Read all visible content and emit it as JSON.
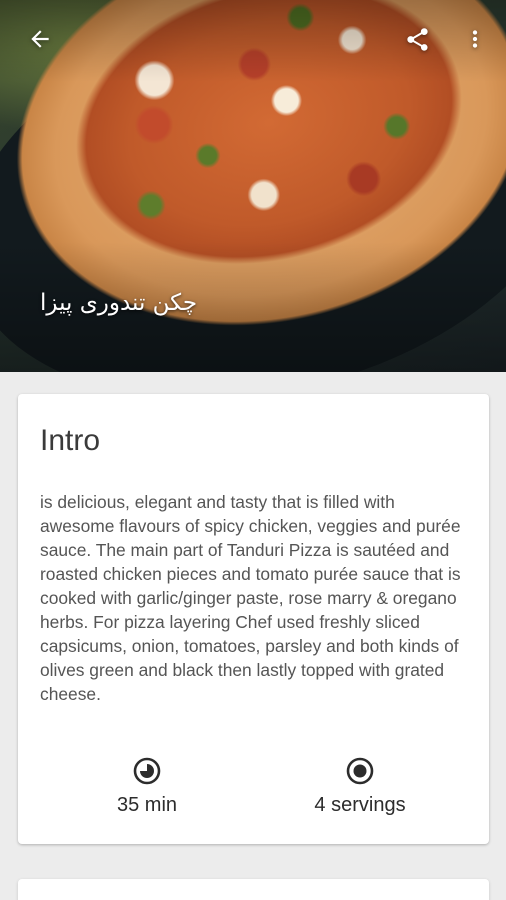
{
  "recipe": {
    "title": "چکن تندوری پیزا"
  },
  "toolbar": {
    "back_icon": "arrow-back-icon",
    "share_icon": "share-icon",
    "more_icon": "more-vert-icon"
  },
  "intro": {
    "heading": "Intro",
    "text": "is delicious, elegant and tasty that is filled with awesome flavours of spicy chicken, veggies and purée sauce. The main part of Tanduri Pizza is sautéed and roasted chicken pieces and tomato purée sauce that is cooked with garlic/ginger paste, rose marry & oregano herbs. For pizza layering Chef used freshly sliced capsicums, onion, tomatoes, parsley and both kinds of olives green and black then lastly topped with grated cheese."
  },
  "stats": {
    "time": {
      "icon": "timer-icon",
      "label": "35 min"
    },
    "servings": {
      "icon": "servings-icon",
      "label": "4 servings"
    }
  },
  "colors": {
    "background": "#ececec",
    "card": "#ffffff",
    "heading_text": "#3a3a3a",
    "body_text": "#555555",
    "meta_text": "#2c2c2c"
  }
}
